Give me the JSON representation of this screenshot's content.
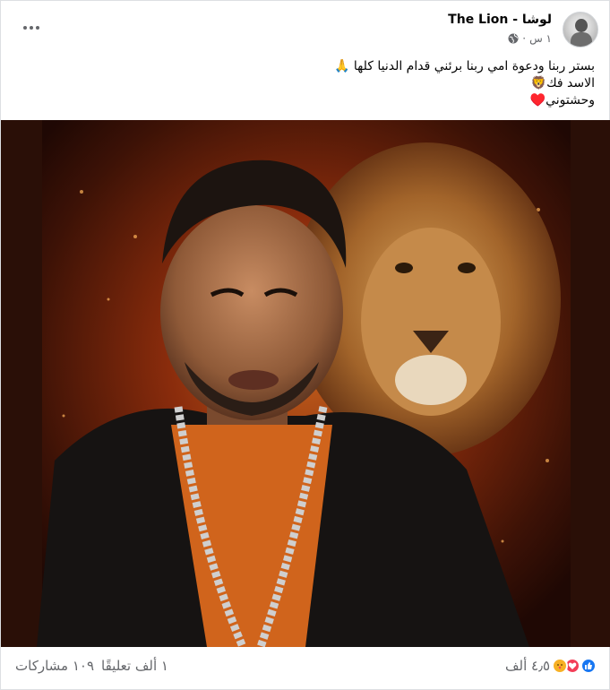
{
  "post": {
    "author": "لوشا - The Lion",
    "time": "١ س",
    "text_lines": [
      "بستر ربنا ودعوة امي ربنا برئني قدام الدنيا كلها 🙏",
      "الاسد فك🦁",
      "وحشتوني♥️"
    ]
  },
  "stats": {
    "reactions_count": "٤٫٥ ألف",
    "comments": "١ ألف تعليقًا",
    "shares": "١٠٩ مشاركات"
  },
  "icons": {
    "privacy": "globe-icon",
    "menu": "more-icon",
    "reactions": [
      "like-icon",
      "love-icon",
      "care-icon"
    ]
  },
  "colors": {
    "like": "#1877f2",
    "love": "#f33e58",
    "care": "#f7b125",
    "secondary_text": "#65676b"
  }
}
